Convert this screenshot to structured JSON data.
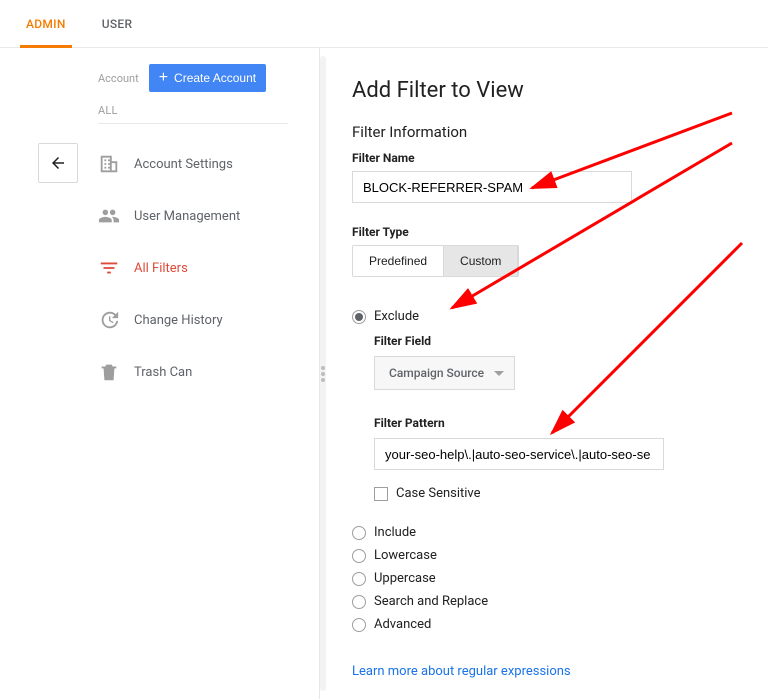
{
  "tabs": {
    "admin": "ADMIN",
    "user": "USER"
  },
  "sidebar": {
    "account_label": "Account",
    "create_button": "Create Account",
    "all_label": "ALL",
    "items": [
      {
        "label": "Account Settings"
      },
      {
        "label": "User Management"
      },
      {
        "label": "All Filters"
      },
      {
        "label": "Change History"
      },
      {
        "label": "Trash Can"
      }
    ]
  },
  "main": {
    "title": "Add Filter to View",
    "info_heading": "Filter Information",
    "filter_name_label": "Filter Name",
    "filter_name_value": "BLOCK-REFERRER-SPAM",
    "filter_type_label": "Filter Type",
    "type_tabs": {
      "predefined": "Predefined",
      "custom": "Custom"
    },
    "radios": {
      "exclude": "Exclude",
      "include": "Include",
      "lowercase": "Lowercase",
      "uppercase": "Uppercase",
      "search_replace": "Search and Replace",
      "advanced": "Advanced"
    },
    "filter_field_label": "Filter Field",
    "filter_field_value": "Campaign Source",
    "filter_pattern_label": "Filter Pattern",
    "filter_pattern_value": "your-seo-help\\.|auto-seo-service\\.|auto-seo-se",
    "case_sensitive": "Case Sensitive",
    "learn_link": "Learn more about regular expressions"
  }
}
